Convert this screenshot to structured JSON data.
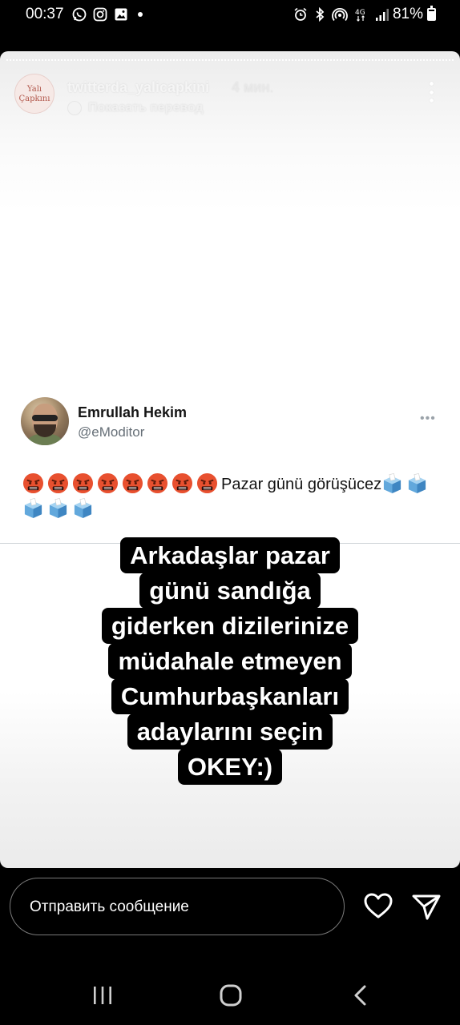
{
  "status_bar": {
    "time": "00:37",
    "battery_text": "81%",
    "battery_level": 0.81,
    "network": "4G",
    "left_icons": [
      "whatsapp-icon",
      "instagram-icon",
      "gallery-icon",
      "dot-icon"
    ],
    "right_icons": [
      "alarm-icon",
      "bluetooth-icon",
      "hotspot-icon",
      "4g-data-icon",
      "signal-icon",
      "battery-icon"
    ]
  },
  "story": {
    "avatar_logo_text": "Yalı Çapkını",
    "username": "twitterda_yalicapkini",
    "time_ago": "4 мин.",
    "translate_label": "Показать перевод"
  },
  "tweet": {
    "name": "Emrullah Hekim",
    "handle": "@eModitor",
    "more": "•••",
    "text": "Pazar günü görüşücez",
    "emojis": [
      "angry-face",
      "angry-face",
      "angry-face",
      "angry-face",
      "angry-face",
      "angry-face",
      "angry-face",
      "angry-face"
    ],
    "ballot_emojis": [
      "ballot-box",
      "ballot-box",
      "ballot-box",
      "ballot-box",
      "ballot-box"
    ]
  },
  "caption": {
    "lines": [
      "Arkadaşlar pazar",
      "günü sandığa",
      "giderken dizilerinize",
      "müdahale etmeyen",
      "Cumhurbaşkanları",
      "adaylarını seçin",
      "OKEY:)"
    ]
  },
  "reply": {
    "placeholder": "Отправить сообщение"
  },
  "colors": {
    "background": "#000000",
    "tweet_text": "#141414",
    "handle": "#666f77",
    "caption_bg": "#000000",
    "angry_emoji": "#e8502f",
    "ballot": "#62a8dc"
  }
}
